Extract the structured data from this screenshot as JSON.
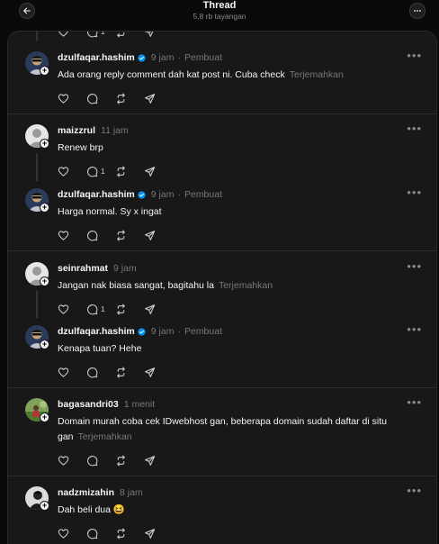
{
  "header": {
    "title": "Thread",
    "views": "5,8 rb tayangan"
  },
  "posts": [
    {
      "username": "dzulfaqar.hashim",
      "time": "9 jam",
      "author_label": "Pembuat",
      "text": "Ada orang reply comment dah kat post ni. Cuba check",
      "translate": "Terjemahkan",
      "reply_count": ""
    },
    {
      "username": "maizzrul",
      "time": "11 jam",
      "author_label": "",
      "text": "Renew brp",
      "translate": "",
      "reply_count": "1"
    },
    {
      "username": "dzulfaqar.hashim",
      "time": "9 jam",
      "author_label": "Pembuat",
      "text": "Harga normal. Sy x ingat",
      "translate": "",
      "reply_count": ""
    },
    {
      "username": "seinrahmat",
      "time": "9 jam",
      "author_label": "",
      "text": "Jangan nak biasa sangat, bagitahu la",
      "translate": "Terjemahkan",
      "reply_count": "1"
    },
    {
      "username": "dzulfaqar.hashim",
      "time": "9 jam",
      "author_label": "Pembuat",
      "text": "Kenapa tuan? Hehe",
      "translate": "",
      "reply_count": ""
    },
    {
      "username": "bagasandri03",
      "time": "1 menit",
      "author_label": "",
      "text_line1": "Domain murah coba cek IDwebhost gan, beberapa domain sudah daftar di situ",
      "text_line2": "gan",
      "translate": "Terjemahkan",
      "reply_count": ""
    },
    {
      "username": "nadzmizahin",
      "time": "8 jam",
      "author_label": "",
      "text": "Dah beli dua 😆",
      "translate": "",
      "reply_count": ""
    }
  ],
  "partial_top_reply_count": "1",
  "colors": {
    "background": "#0a0a0a",
    "panel": "#181818",
    "verified": "#0095f6",
    "muted": "#777777"
  }
}
